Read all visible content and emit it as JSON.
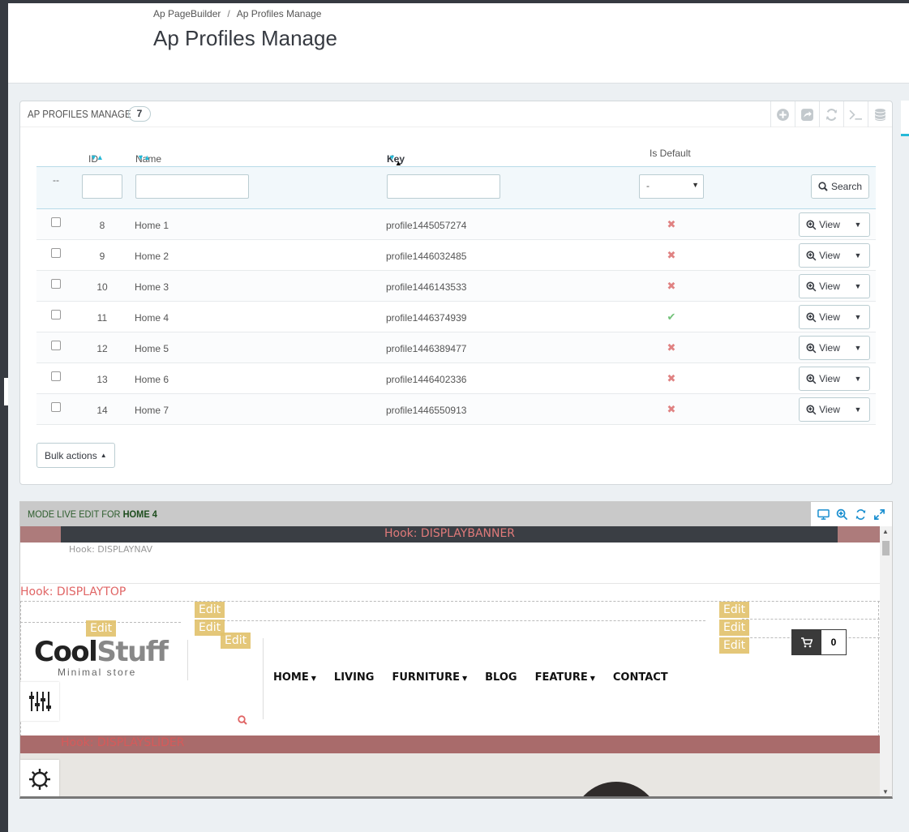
{
  "breadcrumb": {
    "parent": "Ap PageBuilder",
    "separator": "/",
    "current": "Ap Profiles Manage"
  },
  "page_title": "Ap Profiles Manage",
  "panel": {
    "title": "AP PROFILES MANAGE",
    "count": "7",
    "toolbar_icons": [
      "add-icon",
      "export-icon",
      "refresh-icon",
      "sql-icon",
      "database-icon"
    ]
  },
  "table": {
    "headers": {
      "id": "ID",
      "name": "Name",
      "key": "Key",
      "is_default": "Is Default"
    },
    "filter": {
      "bulk_dash": "--",
      "select_value": "-",
      "search_label": "Search"
    },
    "rows": [
      {
        "id": "8",
        "name": "Home 1",
        "key": "profile1445057274",
        "default": false
      },
      {
        "id": "9",
        "name": "Home 2",
        "key": "profile1446032485",
        "default": false
      },
      {
        "id": "10",
        "name": "Home 3",
        "key": "profile1446143533",
        "default": false
      },
      {
        "id": "11",
        "name": "Home 4",
        "key": "profile1446374939",
        "default": true
      },
      {
        "id": "12",
        "name": "Home 5",
        "key": "profile1446389477",
        "default": false
      },
      {
        "id": "13",
        "name": "Home 6",
        "key": "profile1446402336",
        "default": false
      },
      {
        "id": "14",
        "name": "Home 7",
        "key": "profile1446550913",
        "default": false
      }
    ],
    "view_label": "View",
    "bulk_label": "Bulk actions"
  },
  "live": {
    "title_prefix": "MODE LIVE EDIT FOR",
    "title_profile": "HOME 4",
    "hooks": {
      "banner": "Hook: DISPLAYBANNER",
      "nav": "Hook: DISPLAYNAV",
      "top": "Hook: DISPLAYTOP",
      "slider": "Hook: DISPLAYSLIDER"
    },
    "edit_label": "Edit",
    "logo": {
      "part1": "Cool",
      "part2": "Stuff",
      "tagline": "Minimal store"
    },
    "menu": [
      {
        "label": "HOME",
        "dropdown": true
      },
      {
        "label": "LIVING",
        "dropdown": false
      },
      {
        "label": "FURNITURE",
        "dropdown": true
      },
      {
        "label": "BLOG",
        "dropdown": false
      },
      {
        "label": "FEATURE",
        "dropdown": true
      },
      {
        "label": "CONTACT",
        "dropdown": false
      }
    ],
    "cart_count": "0"
  }
}
